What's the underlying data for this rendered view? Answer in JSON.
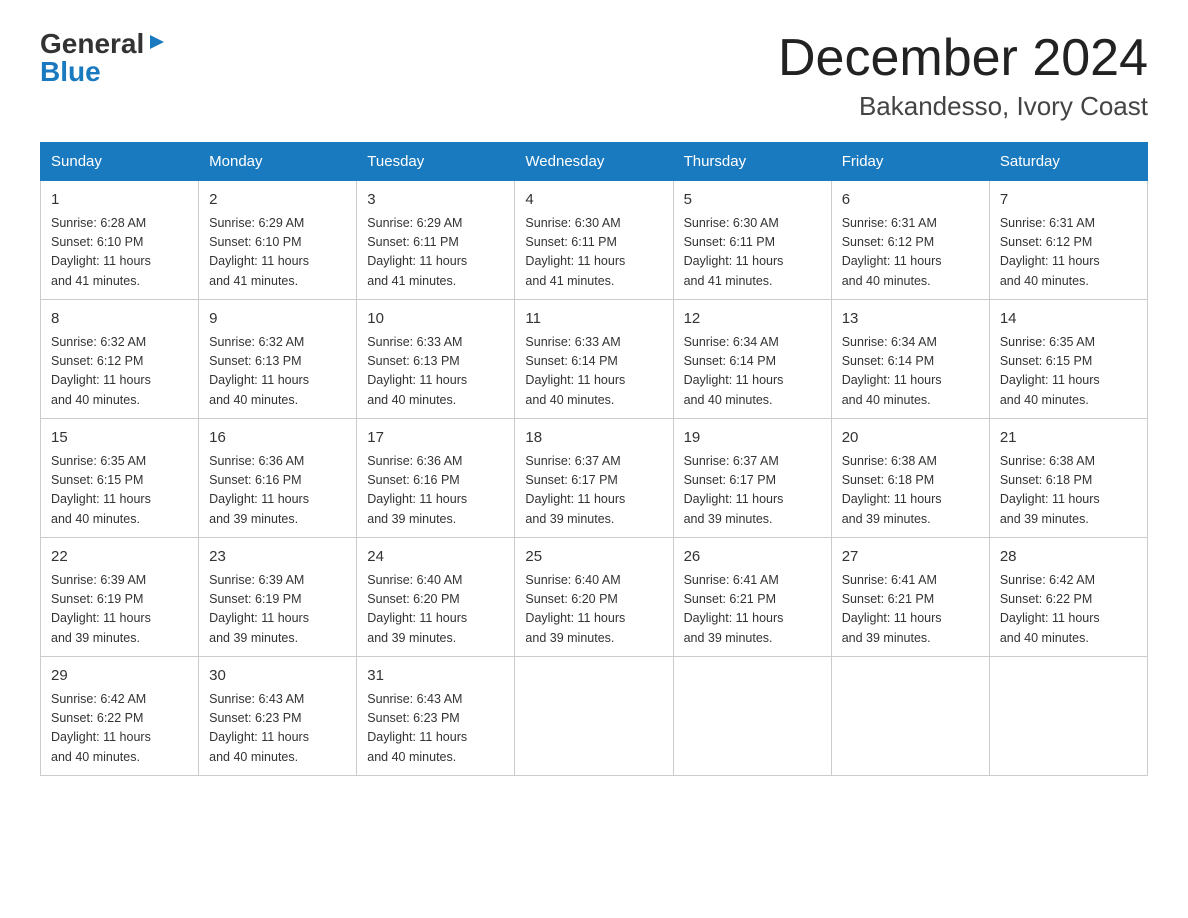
{
  "logo": {
    "general": "General",
    "blue": "Blue"
  },
  "header": {
    "month": "December 2024",
    "location": "Bakandesso, Ivory Coast"
  },
  "days_of_week": [
    "Sunday",
    "Monday",
    "Tuesday",
    "Wednesday",
    "Thursday",
    "Friday",
    "Saturday"
  ],
  "weeks": [
    [
      {
        "day": "1",
        "sunrise": "6:28 AM",
        "sunset": "6:10 PM",
        "daylight": "11 hours and 41 minutes."
      },
      {
        "day": "2",
        "sunrise": "6:29 AM",
        "sunset": "6:10 PM",
        "daylight": "11 hours and 41 minutes."
      },
      {
        "day": "3",
        "sunrise": "6:29 AM",
        "sunset": "6:11 PM",
        "daylight": "11 hours and 41 minutes."
      },
      {
        "day": "4",
        "sunrise": "6:30 AM",
        "sunset": "6:11 PM",
        "daylight": "11 hours and 41 minutes."
      },
      {
        "day": "5",
        "sunrise": "6:30 AM",
        "sunset": "6:11 PM",
        "daylight": "11 hours and 41 minutes."
      },
      {
        "day": "6",
        "sunrise": "6:31 AM",
        "sunset": "6:12 PM",
        "daylight": "11 hours and 40 minutes."
      },
      {
        "day": "7",
        "sunrise": "6:31 AM",
        "sunset": "6:12 PM",
        "daylight": "11 hours and 40 minutes."
      }
    ],
    [
      {
        "day": "8",
        "sunrise": "6:32 AM",
        "sunset": "6:12 PM",
        "daylight": "11 hours and 40 minutes."
      },
      {
        "day": "9",
        "sunrise": "6:32 AM",
        "sunset": "6:13 PM",
        "daylight": "11 hours and 40 minutes."
      },
      {
        "day": "10",
        "sunrise": "6:33 AM",
        "sunset": "6:13 PM",
        "daylight": "11 hours and 40 minutes."
      },
      {
        "day": "11",
        "sunrise": "6:33 AM",
        "sunset": "6:14 PM",
        "daylight": "11 hours and 40 minutes."
      },
      {
        "day": "12",
        "sunrise": "6:34 AM",
        "sunset": "6:14 PM",
        "daylight": "11 hours and 40 minutes."
      },
      {
        "day": "13",
        "sunrise": "6:34 AM",
        "sunset": "6:14 PM",
        "daylight": "11 hours and 40 minutes."
      },
      {
        "day": "14",
        "sunrise": "6:35 AM",
        "sunset": "6:15 PM",
        "daylight": "11 hours and 40 minutes."
      }
    ],
    [
      {
        "day": "15",
        "sunrise": "6:35 AM",
        "sunset": "6:15 PM",
        "daylight": "11 hours and 40 minutes."
      },
      {
        "day": "16",
        "sunrise": "6:36 AM",
        "sunset": "6:16 PM",
        "daylight": "11 hours and 39 minutes."
      },
      {
        "day": "17",
        "sunrise": "6:36 AM",
        "sunset": "6:16 PM",
        "daylight": "11 hours and 39 minutes."
      },
      {
        "day": "18",
        "sunrise": "6:37 AM",
        "sunset": "6:17 PM",
        "daylight": "11 hours and 39 minutes."
      },
      {
        "day": "19",
        "sunrise": "6:37 AM",
        "sunset": "6:17 PM",
        "daylight": "11 hours and 39 minutes."
      },
      {
        "day": "20",
        "sunrise": "6:38 AM",
        "sunset": "6:18 PM",
        "daylight": "11 hours and 39 minutes."
      },
      {
        "day": "21",
        "sunrise": "6:38 AM",
        "sunset": "6:18 PM",
        "daylight": "11 hours and 39 minutes."
      }
    ],
    [
      {
        "day": "22",
        "sunrise": "6:39 AM",
        "sunset": "6:19 PM",
        "daylight": "11 hours and 39 minutes."
      },
      {
        "day": "23",
        "sunrise": "6:39 AM",
        "sunset": "6:19 PM",
        "daylight": "11 hours and 39 minutes."
      },
      {
        "day": "24",
        "sunrise": "6:40 AM",
        "sunset": "6:20 PM",
        "daylight": "11 hours and 39 minutes."
      },
      {
        "day": "25",
        "sunrise": "6:40 AM",
        "sunset": "6:20 PM",
        "daylight": "11 hours and 39 minutes."
      },
      {
        "day": "26",
        "sunrise": "6:41 AM",
        "sunset": "6:21 PM",
        "daylight": "11 hours and 39 minutes."
      },
      {
        "day": "27",
        "sunrise": "6:41 AM",
        "sunset": "6:21 PM",
        "daylight": "11 hours and 39 minutes."
      },
      {
        "day": "28",
        "sunrise": "6:42 AM",
        "sunset": "6:22 PM",
        "daylight": "11 hours and 40 minutes."
      }
    ],
    [
      {
        "day": "29",
        "sunrise": "6:42 AM",
        "sunset": "6:22 PM",
        "daylight": "11 hours and 40 minutes."
      },
      {
        "day": "30",
        "sunrise": "6:43 AM",
        "sunset": "6:23 PM",
        "daylight": "11 hours and 40 minutes."
      },
      {
        "day": "31",
        "sunrise": "6:43 AM",
        "sunset": "6:23 PM",
        "daylight": "11 hours and 40 minutes."
      },
      null,
      null,
      null,
      null
    ]
  ],
  "labels": {
    "sunrise": "Sunrise:",
    "sunset": "Sunset:",
    "daylight": "Daylight:"
  }
}
